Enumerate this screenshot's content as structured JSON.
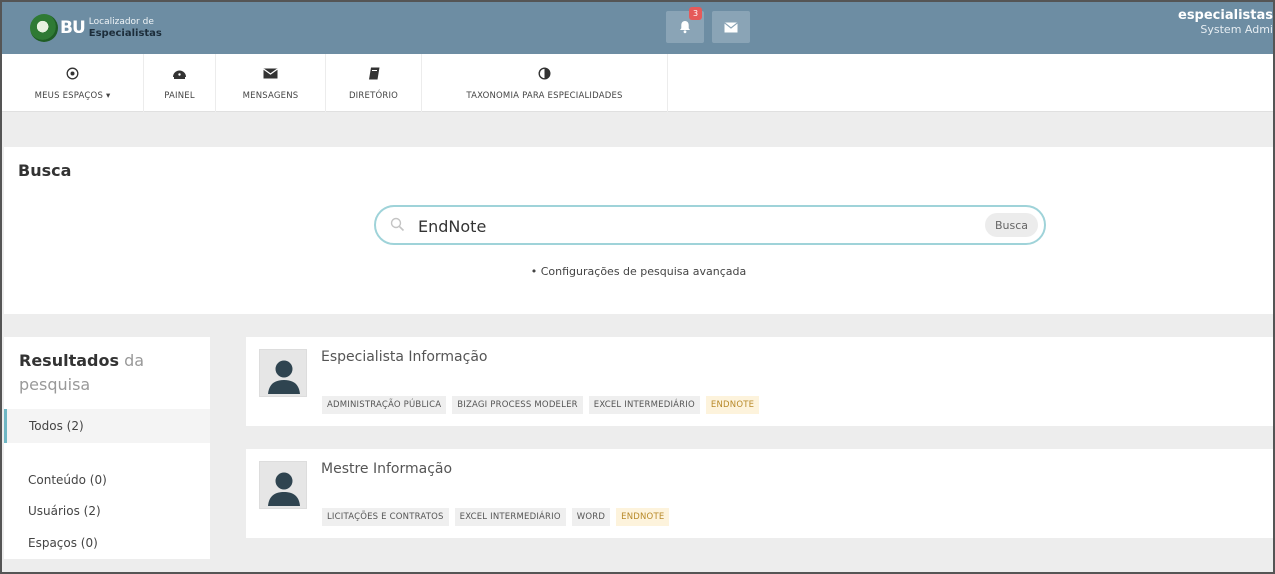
{
  "header": {
    "logo_text": "BU",
    "logo_line1": "Localizador de",
    "logo_line2": "Especialistas",
    "notification_count": "3",
    "user_name": "especialistas",
    "user_role": "System Admi"
  },
  "nav": {
    "items": [
      {
        "label": "MEUS ESPAÇOS ▾",
        "icon": "target-circle-icon"
      },
      {
        "label": "PAINEL",
        "icon": "dashboard-icon"
      },
      {
        "label": "MENSAGENS",
        "icon": "envelope-icon"
      },
      {
        "label": "DIRETÓRIO",
        "icon": "book-icon"
      },
      {
        "label": "TAXONOMIA PARA ESPECIALIDADES",
        "icon": "half-circle-icon"
      }
    ]
  },
  "search": {
    "title": "Busca",
    "value": "EndNote",
    "button_label": "Busca",
    "advanced_link": "• Configurações de pesquisa avançada"
  },
  "results_sidebar": {
    "title_bold": "Resultados",
    "title_light": "da pesquisa",
    "filters": [
      {
        "label": "Todos (2)",
        "active": true
      },
      {
        "label": "Conteúdo (0)",
        "active": false
      },
      {
        "label": "Usuários (2)",
        "active": false
      },
      {
        "label": "Espaços (0)",
        "active": false
      }
    ]
  },
  "results": [
    {
      "name": "Especialista Informação",
      "tags": [
        "ADMINISTRAÇÃO PÚBLICA",
        "BIZAGI PROCESS MODELER",
        "EXCEL INTERMEDIÁRIO",
        "ENDNOTE"
      ]
    },
    {
      "name": "Mestre Informação",
      "tags": [
        "LICITAÇÕES E CONTRATOS",
        "EXCEL INTERMEDIÁRIO",
        "WORD",
        "ENDNOTE"
      ]
    }
  ],
  "colors": {
    "header_bg": "#6d8da3",
    "search_border": "#9fd3d9",
    "highlight_tag_bg": "#fdf3dc",
    "highlight_tag_text": "#b88a2a"
  }
}
